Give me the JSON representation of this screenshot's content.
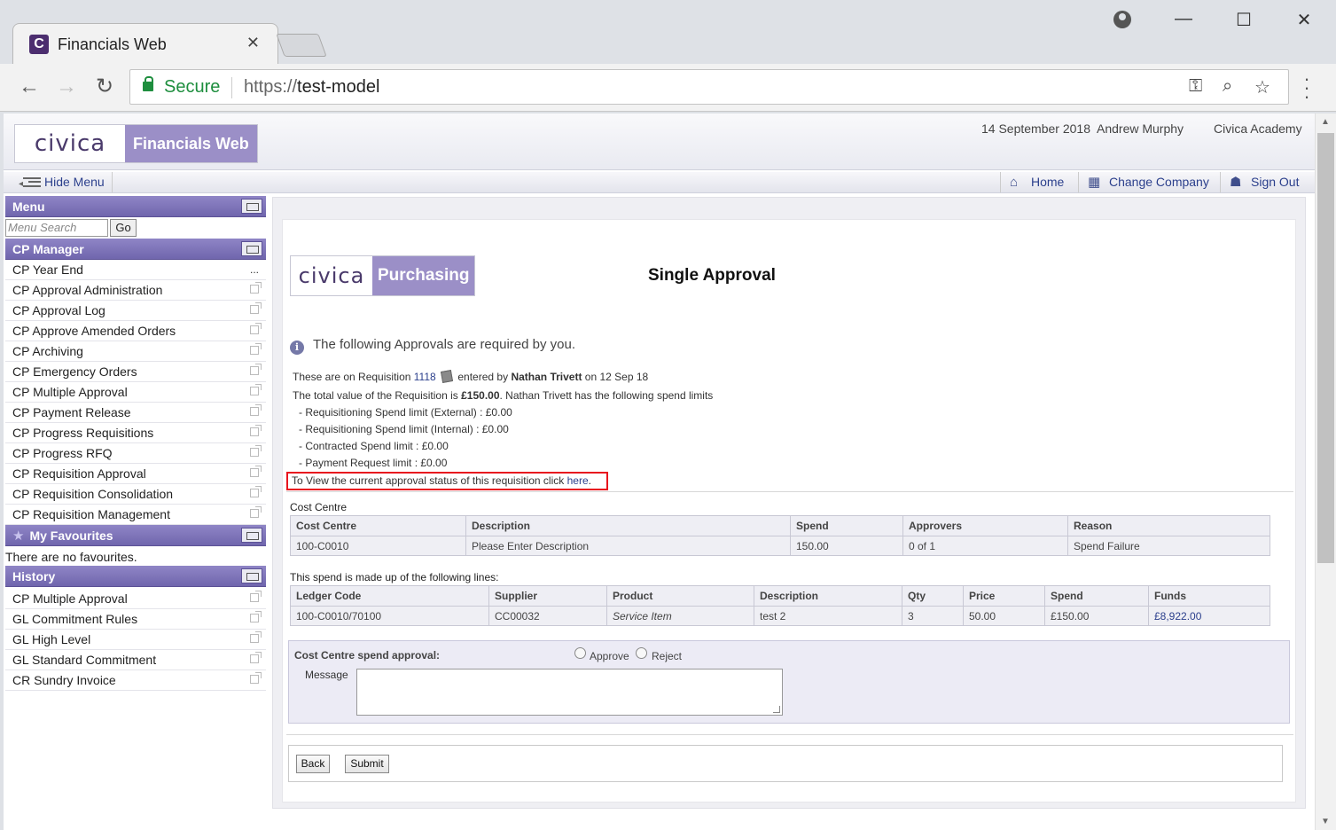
{
  "browser": {
    "tab_title": "Financials Web",
    "tab_close": "✕",
    "favicon_letter": "C",
    "secure_label": "Secure",
    "url_scheme": "https://",
    "url_host": "test-model"
  },
  "header": {
    "logo_civica": "civica",
    "logo_product": "Financials Web",
    "date": "14 September 2018",
    "user": "Andrew Murphy",
    "company": "Civica Academy"
  },
  "subbar": {
    "hide_menu": "Hide Menu",
    "home": "Home",
    "change_company": "Change Company",
    "sign_out": "Sign Out"
  },
  "sidebar": {
    "menu_title": "Menu",
    "search_placeholder": "Menu Search",
    "go_label": "Go",
    "cp_manager_title": "CP Manager",
    "cp_items": [
      "CP Year End",
      "CP Approval Administration",
      "CP Approval Log",
      "CP Approve Amended Orders",
      "CP Archiving",
      "CP Emergency Orders",
      "CP Multiple Approval",
      "CP Payment Release",
      "CP Progress Requisitions",
      "CP Progress RFQ",
      "CP Requisition Approval",
      "CP Requisition Consolidation",
      "CP Requisition Management"
    ],
    "favourites_title": "My Favourites",
    "no_favourites": "There are no favourites.",
    "history_title": "History",
    "history_items": [
      "CP Multiple Approval",
      "GL Commitment Rules",
      "GL High Level",
      "GL Standard Commitment",
      "CR Sundry Invoice"
    ]
  },
  "main": {
    "logo_civica": "civica",
    "logo_product": "Purchasing",
    "title": "Single Approval",
    "info": "The following Approvals are required by you.",
    "req_prefix": "These are on Requisition",
    "req_number": "1118",
    "req_entered_by": "entered by",
    "req_user": "Nathan Trivett",
    "req_on": "on 12 Sep 18",
    "total_prefix": "The total value of the Requisition is",
    "total_value": "£150.00",
    "total_suffix": ". Nathan Trivett has the following spend limits",
    "limits": [
      "- Requisitioning Spend limit (External) : £0.00",
      "- Requisitioning Spend limit (Internal) : £0.00",
      "- Contracted Spend limit : £0.00",
      "- Payment Request limit : £0.00"
    ],
    "status_text": "To View the current approval status of this requisition click",
    "status_link": "here",
    "status_period": ".",
    "cost_centre_label": "Cost Centre",
    "cost_centre_table": {
      "headers": [
        "Cost Centre",
        "Description",
        "Spend",
        "Approvers",
        "Reason"
      ],
      "rows": [
        [
          "100-C0010",
          "Please Enter Description",
          "150.00",
          "0 of 1",
          "Spend Failure"
        ]
      ]
    },
    "lines_label": "This spend is made up of the following lines:",
    "lines_table": {
      "headers": [
        "Ledger Code",
        "Supplier",
        "Product",
        "Description",
        "Qty",
        "Price",
        "Spend",
        "Funds"
      ],
      "rows": [
        [
          "100-C0010/70100",
          "CC00032",
          "Service Item",
          "test 2",
          "3",
          "50.00",
          "£150.00",
          "£8,922.00"
        ]
      ]
    },
    "approval_label": "Cost Centre spend approval:",
    "approve_label": "Approve",
    "reject_label": "Reject",
    "message_label": "Message",
    "back_label": "Back",
    "submit_label": "Submit"
  }
}
